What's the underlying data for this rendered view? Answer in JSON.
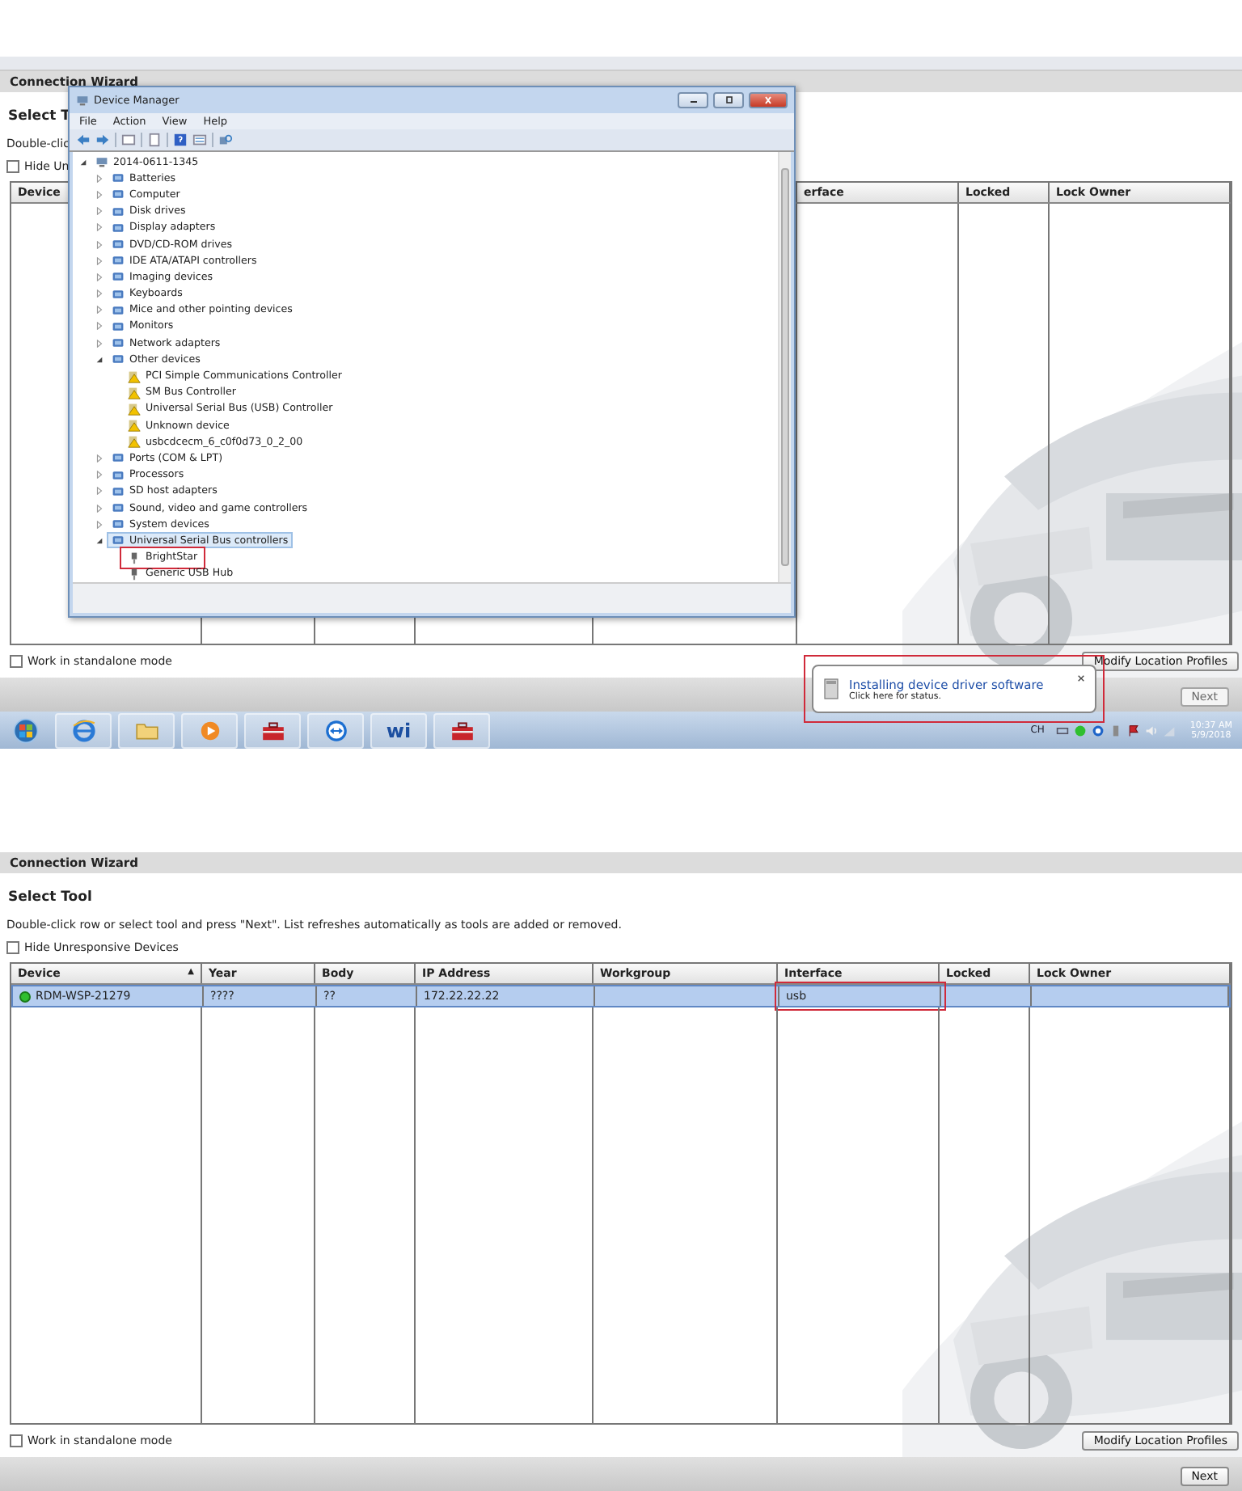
{
  "top_screen": {
    "wizard": {
      "title": "Connection Wizard",
      "heading": "Select T",
      "instructions": "Double-clic",
      "hide_checkbox": {
        "label": "Hide Un",
        "checked": false
      },
      "columns": [
        {
          "label": "Device"
        },
        {
          "label": "erface"
        },
        {
          "label": "Locked"
        },
        {
          "label": "Lock Owner"
        }
      ],
      "standalone_checkbox": {
        "label": "Work in standalone mode",
        "checked": false
      },
      "buttons": [
        {
          "label": "Modify Location Profiles",
          "disabled": false
        },
        {
          "label": "Next",
          "disabled": true
        }
      ]
    },
    "device_manager": {
      "title": "Device Manager",
      "menu": [
        "File",
        "Action",
        "View",
        "Help"
      ],
      "tree": [
        {
          "label": "2014-0611-1345",
          "kind": "computer",
          "expanded": true,
          "selected": false,
          "children": [
            {
              "label": "Batteries",
              "kind": "device",
              "expanded": false,
              "selected": false
            },
            {
              "label": "Computer",
              "kind": "device",
              "expanded": false,
              "selected": false
            },
            {
              "label": "Disk drives",
              "kind": "device",
              "expanded": false,
              "selected": false
            },
            {
              "label": "Display adapters",
              "kind": "device",
              "expanded": false,
              "selected": false
            },
            {
              "label": "DVD/CD-ROM drives",
              "kind": "device",
              "expanded": false,
              "selected": false
            },
            {
              "label": "IDE ATA/ATAPI controllers",
              "kind": "device",
              "expanded": false,
              "selected": false
            },
            {
              "label": "Imaging devices",
              "kind": "device",
              "expanded": false,
              "selected": false
            },
            {
              "label": "Keyboards",
              "kind": "device",
              "expanded": false,
              "selected": false
            },
            {
              "label": "Mice and other pointing devices",
              "kind": "device",
              "expanded": false,
              "selected": false
            },
            {
              "label": "Monitors",
              "kind": "device",
              "expanded": false,
              "selected": false
            },
            {
              "label": "Network adapters",
              "kind": "device",
              "expanded": false,
              "selected": false
            },
            {
              "label": "Other devices",
              "kind": "device",
              "expanded": true,
              "selected": false,
              "children": [
                {
                  "label": "PCI Simple Communications Controller",
                  "kind": "warning",
                  "selected": false
                },
                {
                  "label": "SM Bus Controller",
                  "kind": "warning",
                  "selected": false
                },
                {
                  "label": "Universal Serial Bus (USB) Controller",
                  "kind": "warning",
                  "selected": false
                },
                {
                  "label": "Unknown device",
                  "kind": "warning",
                  "selected": false
                },
                {
                  "label": "usbcdcecm_6_c0f0d73_0_2_00",
                  "kind": "warning",
                  "selected": false
                }
              ]
            },
            {
              "label": "Ports (COM & LPT)",
              "kind": "device",
              "expanded": false,
              "selected": false
            },
            {
              "label": "Processors",
              "kind": "device",
              "expanded": false,
              "selected": false
            },
            {
              "label": "SD host adapters",
              "kind": "device",
              "expanded": false,
              "selected": false
            },
            {
              "label": "Sound, video and game controllers",
              "kind": "device",
              "expanded": false,
              "selected": false
            },
            {
              "label": "System devices",
              "kind": "device",
              "expanded": false,
              "selected": false
            },
            {
              "label": "Universal Serial Bus controllers",
              "kind": "device",
              "expanded": true,
              "selected": true,
              "children": [
                {
                  "label": "BrightStar",
                  "kind": "plug",
                  "selected": false,
                  "annotated": true
                },
                {
                  "label": "Generic USB Hub",
                  "kind": "plug",
                  "selected": false,
                  "annotated": false
                }
              ]
            }
          ]
        }
      ]
    },
    "notification": {
      "title": "Installing device driver software",
      "subtitle": "Click here for status.",
      "annotated": true
    },
    "taskbar": {
      "apps": [
        {
          "kind": "start"
        },
        {
          "kind": "browser"
        },
        {
          "kind": "folder"
        },
        {
          "kind": "media"
        },
        {
          "kind": "toolbox"
        },
        {
          "kind": "remote"
        },
        {
          "kind": "text",
          "label": "wi"
        },
        {
          "kind": "toolbox"
        }
      ],
      "tray": {
        "language": "CH",
        "time": "10:37 AM",
        "date": "5/9/2018"
      }
    }
  },
  "bottom_screen": {
    "wizard": {
      "title": "Connection Wizard",
      "heading": "Select Tool",
      "instructions": "Double-click row or select tool and press \"Next\".  List refreshes automatically as tools are added or removed.",
      "hide_checkbox": {
        "label": "Hide Unresponsive Devices",
        "checked": false
      },
      "columns": [
        {
          "label": "Device",
          "sort": "▲"
        },
        {
          "label": "Year"
        },
        {
          "label": "Body"
        },
        {
          "label": "IP Address"
        },
        {
          "label": "Workgroup"
        },
        {
          "label": "Interface"
        },
        {
          "label": "Locked"
        },
        {
          "label": "Lock Owner"
        }
      ],
      "rows": [
        {
          "selected": true,
          "color": "#2fbf2f",
          "device": "RDM-WSP-21279",
          "year": "????",
          "body": "??",
          "ip_address": "172.22.22.22",
          "interface": "usb",
          "interface_annotated": true
        }
      ],
      "standalone_checkbox": {
        "label": "Work in standalone mode",
        "checked": false
      },
      "buttons": [
        {
          "label": "Modify Location Profiles",
          "disabled": false
        },
        {
          "label": "Next",
          "disabled": false
        }
      ]
    }
  }
}
